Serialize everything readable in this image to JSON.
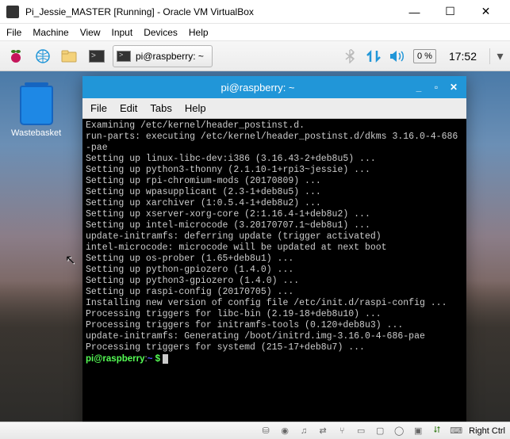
{
  "window": {
    "title": "Pi_Jessie_MASTER [Running] - Oracle VM VirtualBox",
    "min": "—",
    "max": "☐",
    "close": "✕"
  },
  "menubar": [
    "File",
    "Machine",
    "View",
    "Input",
    "Devices",
    "Help"
  ],
  "taskbar": {
    "task_label": "pi@raspberry: ~",
    "battery": "0 %",
    "clock": "17:52"
  },
  "desktop": {
    "trash_label": "Wastebasket"
  },
  "terminal": {
    "title": "pi@raspberry: ~",
    "menu": [
      "File",
      "Edit",
      "Tabs",
      "Help"
    ],
    "prompt_user": "pi@raspberry",
    "prompt_path": "~",
    "prompt_sym": "$",
    "lines": [
      "Examining /etc/kernel/header_postinst.d.",
      "run-parts: executing /etc/kernel/header_postinst.d/dkms 3.16.0-4-686-pae",
      "Setting up linux-libc-dev:i386 (3.16.43-2+deb8u5) ...",
      "Setting up python3-thonny (2.1.10-1+rpi3~jessie) ...",
      "Setting up rpi-chromium-mods (20170809) ...",
      "Setting up wpasupplicant (2.3-1+deb8u5) ...",
      "Setting up xarchiver (1:0.5.4-1+deb8u2) ...",
      "Setting up xserver-xorg-core (2:1.16.4-1+deb8u2) ...",
      "Setting up intel-microcode (3.20170707.1~deb8u1) ...",
      "update-initramfs: deferring update (trigger activated)",
      "intel-microcode: microcode will be updated at next boot",
      "Setting up os-prober (1.65+deb8u1) ...",
      "Setting up python-gpiozero (1.4.0) ...",
      "Setting up python3-gpiozero (1.4.0) ...",
      "Setting up raspi-config (20170705) ...",
      "Installing new version of config file /etc/init.d/raspi-config ...",
      "Processing triggers for libc-bin (2.19-18+deb8u10) ...",
      "Processing triggers for initramfs-tools (0.120+deb8u3) ...",
      "update-initramfs: Generating /boot/initrd.img-3.16.0-4-686-pae",
      "Processing triggers for systemd (215-17+deb8u7) ..."
    ]
  },
  "statusbar": {
    "rightctrl": "Right Ctrl"
  }
}
